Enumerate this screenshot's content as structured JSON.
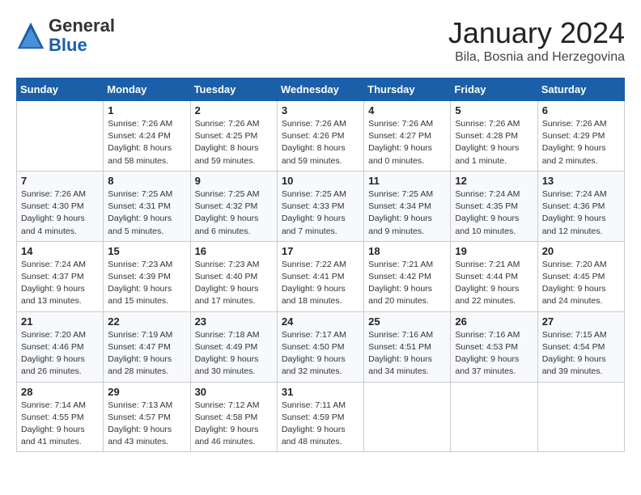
{
  "header": {
    "logo_general": "General",
    "logo_blue": "Blue",
    "month_title": "January 2024",
    "location": "Bila, Bosnia and Herzegovina"
  },
  "weekdays": [
    "Sunday",
    "Monday",
    "Tuesday",
    "Wednesday",
    "Thursday",
    "Friday",
    "Saturday"
  ],
  "weeks": [
    [
      {
        "day": "",
        "info": ""
      },
      {
        "day": "1",
        "info": "Sunrise: 7:26 AM\nSunset: 4:24 PM\nDaylight: 8 hours\nand 58 minutes."
      },
      {
        "day": "2",
        "info": "Sunrise: 7:26 AM\nSunset: 4:25 PM\nDaylight: 8 hours\nand 59 minutes."
      },
      {
        "day": "3",
        "info": "Sunrise: 7:26 AM\nSunset: 4:26 PM\nDaylight: 8 hours\nand 59 minutes."
      },
      {
        "day": "4",
        "info": "Sunrise: 7:26 AM\nSunset: 4:27 PM\nDaylight: 9 hours\nand 0 minutes."
      },
      {
        "day": "5",
        "info": "Sunrise: 7:26 AM\nSunset: 4:28 PM\nDaylight: 9 hours\nand 1 minute."
      },
      {
        "day": "6",
        "info": "Sunrise: 7:26 AM\nSunset: 4:29 PM\nDaylight: 9 hours\nand 2 minutes."
      }
    ],
    [
      {
        "day": "7",
        "info": "Sunrise: 7:26 AM\nSunset: 4:30 PM\nDaylight: 9 hours\nand 4 minutes."
      },
      {
        "day": "8",
        "info": "Sunrise: 7:25 AM\nSunset: 4:31 PM\nDaylight: 9 hours\nand 5 minutes."
      },
      {
        "day": "9",
        "info": "Sunrise: 7:25 AM\nSunset: 4:32 PM\nDaylight: 9 hours\nand 6 minutes."
      },
      {
        "day": "10",
        "info": "Sunrise: 7:25 AM\nSunset: 4:33 PM\nDaylight: 9 hours\nand 7 minutes."
      },
      {
        "day": "11",
        "info": "Sunrise: 7:25 AM\nSunset: 4:34 PM\nDaylight: 9 hours\nand 9 minutes."
      },
      {
        "day": "12",
        "info": "Sunrise: 7:24 AM\nSunset: 4:35 PM\nDaylight: 9 hours\nand 10 minutes."
      },
      {
        "day": "13",
        "info": "Sunrise: 7:24 AM\nSunset: 4:36 PM\nDaylight: 9 hours\nand 12 minutes."
      }
    ],
    [
      {
        "day": "14",
        "info": "Sunrise: 7:24 AM\nSunset: 4:37 PM\nDaylight: 9 hours\nand 13 minutes."
      },
      {
        "day": "15",
        "info": "Sunrise: 7:23 AM\nSunset: 4:39 PM\nDaylight: 9 hours\nand 15 minutes."
      },
      {
        "day": "16",
        "info": "Sunrise: 7:23 AM\nSunset: 4:40 PM\nDaylight: 9 hours\nand 17 minutes."
      },
      {
        "day": "17",
        "info": "Sunrise: 7:22 AM\nSunset: 4:41 PM\nDaylight: 9 hours\nand 18 minutes."
      },
      {
        "day": "18",
        "info": "Sunrise: 7:21 AM\nSunset: 4:42 PM\nDaylight: 9 hours\nand 20 minutes."
      },
      {
        "day": "19",
        "info": "Sunrise: 7:21 AM\nSunset: 4:44 PM\nDaylight: 9 hours\nand 22 minutes."
      },
      {
        "day": "20",
        "info": "Sunrise: 7:20 AM\nSunset: 4:45 PM\nDaylight: 9 hours\nand 24 minutes."
      }
    ],
    [
      {
        "day": "21",
        "info": "Sunrise: 7:20 AM\nSunset: 4:46 PM\nDaylight: 9 hours\nand 26 minutes."
      },
      {
        "day": "22",
        "info": "Sunrise: 7:19 AM\nSunset: 4:47 PM\nDaylight: 9 hours\nand 28 minutes."
      },
      {
        "day": "23",
        "info": "Sunrise: 7:18 AM\nSunset: 4:49 PM\nDaylight: 9 hours\nand 30 minutes."
      },
      {
        "day": "24",
        "info": "Sunrise: 7:17 AM\nSunset: 4:50 PM\nDaylight: 9 hours\nand 32 minutes."
      },
      {
        "day": "25",
        "info": "Sunrise: 7:16 AM\nSunset: 4:51 PM\nDaylight: 9 hours\nand 34 minutes."
      },
      {
        "day": "26",
        "info": "Sunrise: 7:16 AM\nSunset: 4:53 PM\nDaylight: 9 hours\nand 37 minutes."
      },
      {
        "day": "27",
        "info": "Sunrise: 7:15 AM\nSunset: 4:54 PM\nDaylight: 9 hours\nand 39 minutes."
      }
    ],
    [
      {
        "day": "28",
        "info": "Sunrise: 7:14 AM\nSunset: 4:55 PM\nDaylight: 9 hours\nand 41 minutes."
      },
      {
        "day": "29",
        "info": "Sunrise: 7:13 AM\nSunset: 4:57 PM\nDaylight: 9 hours\nand 43 minutes."
      },
      {
        "day": "30",
        "info": "Sunrise: 7:12 AM\nSunset: 4:58 PM\nDaylight: 9 hours\nand 46 minutes."
      },
      {
        "day": "31",
        "info": "Sunrise: 7:11 AM\nSunset: 4:59 PM\nDaylight: 9 hours\nand 48 minutes."
      },
      {
        "day": "",
        "info": ""
      },
      {
        "day": "",
        "info": ""
      },
      {
        "day": "",
        "info": ""
      }
    ]
  ]
}
